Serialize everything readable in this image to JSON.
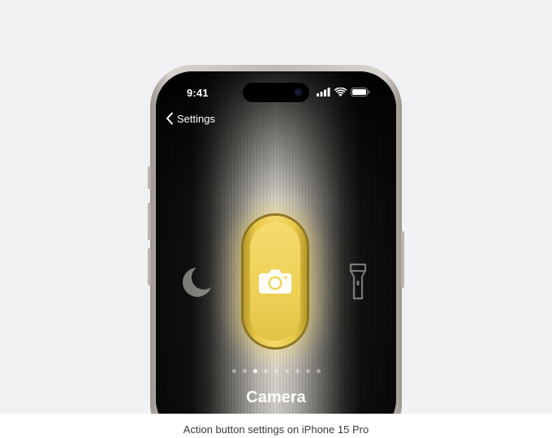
{
  "status_bar": {
    "time": "9:41",
    "icons": [
      "cellular-signal-icon",
      "wifi-icon",
      "battery-icon"
    ]
  },
  "nav": {
    "back_label": "Settings",
    "back_icon": "chevron-left-icon"
  },
  "action_options": {
    "left_icon": "moon-icon",
    "selected_icon": "camera-icon",
    "right_icon": "flashlight-icon",
    "selected_label": "Camera",
    "page_dots": {
      "count": 9,
      "active_index": 2
    }
  },
  "caption": "Action button settings on iPhone 15 Pro",
  "colors": {
    "accent_yellow": "#f0d35e",
    "stage_background": "#f2f2f4",
    "screen_black": "#060606"
  }
}
